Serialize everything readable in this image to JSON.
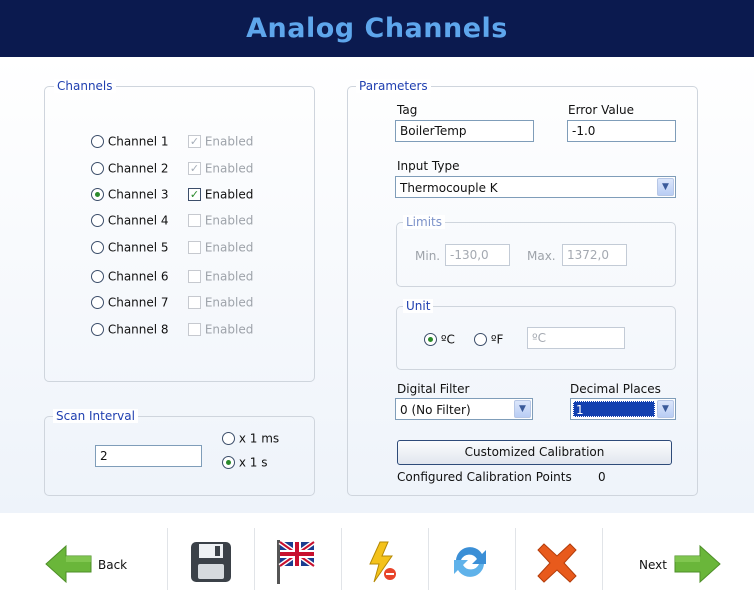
{
  "header": {
    "title": "Analog Channels"
  },
  "channels": {
    "legend": "Channels",
    "items": [
      {
        "label": "Channel 1",
        "enabled_label": "Enabled",
        "selected": false,
        "enabled": true
      },
      {
        "label": "Channel 2",
        "enabled_label": "Enabled",
        "selected": false,
        "enabled": true
      },
      {
        "label": "Channel 3",
        "enabled_label": "Enabled",
        "selected": true,
        "enabled": true
      },
      {
        "label": "Channel 4",
        "enabled_label": "Enabled",
        "selected": false,
        "enabled": false
      },
      {
        "label": "Channel 5",
        "enabled_label": "Enabled",
        "selected": false,
        "enabled": false
      },
      {
        "label": "Channel 6",
        "enabled_label": "Enabled",
        "selected": false,
        "enabled": false
      },
      {
        "label": "Channel 7",
        "enabled_label": "Enabled",
        "selected": false,
        "enabled": false
      },
      {
        "label": "Channel 8",
        "enabled_label": "Enabled",
        "selected": false,
        "enabled": false
      }
    ]
  },
  "scan_interval": {
    "legend": "Scan Interval",
    "value": "2",
    "options": [
      {
        "label": "x 1 ms",
        "selected": false
      },
      {
        "label": "x 1 s",
        "selected": true
      }
    ]
  },
  "parameters": {
    "legend": "Parameters",
    "tag_label": "Tag",
    "tag_value": "BoilerTemp",
    "error_label": "Error Value",
    "error_value": "-1.0",
    "input_type_label": "Input Type",
    "input_type_value": "Thermocouple K",
    "limits": {
      "legend": "Limits",
      "min_label": "Min.",
      "min_value": "-130,0",
      "max_label": "Max.",
      "max_value": "1372,0"
    },
    "unit": {
      "legend": "Unit",
      "celsius_label": "ºC",
      "fahrenheit_label": "ºF",
      "selected": "celsius",
      "custom_value": "ºC"
    },
    "digital_filter_label": "Digital Filter",
    "digital_filter_value": "0 (No Filter)",
    "decimal_places_label": "Decimal Places",
    "decimal_places_value": "1",
    "calibration_button": "Customized Calibration",
    "calibration_points_label": "Configured Calibration Points",
    "calibration_points_value": "0"
  },
  "toolbar": {
    "back_label": "Back",
    "next_label": "Next",
    "icons": [
      "back-arrow-icon",
      "save-icon",
      "language-flag-icon",
      "lightning-icon",
      "refresh-icon",
      "delete-icon",
      "next-arrow-icon"
    ]
  },
  "colors": {
    "header_bg": "#0b1a4f",
    "header_text": "#5ea6ec",
    "legend_text": "#1f3fb0",
    "radio_dot": "#2b8a2b",
    "arrow_green": "#6ab63a",
    "delete_orange": "#e85a1c"
  }
}
